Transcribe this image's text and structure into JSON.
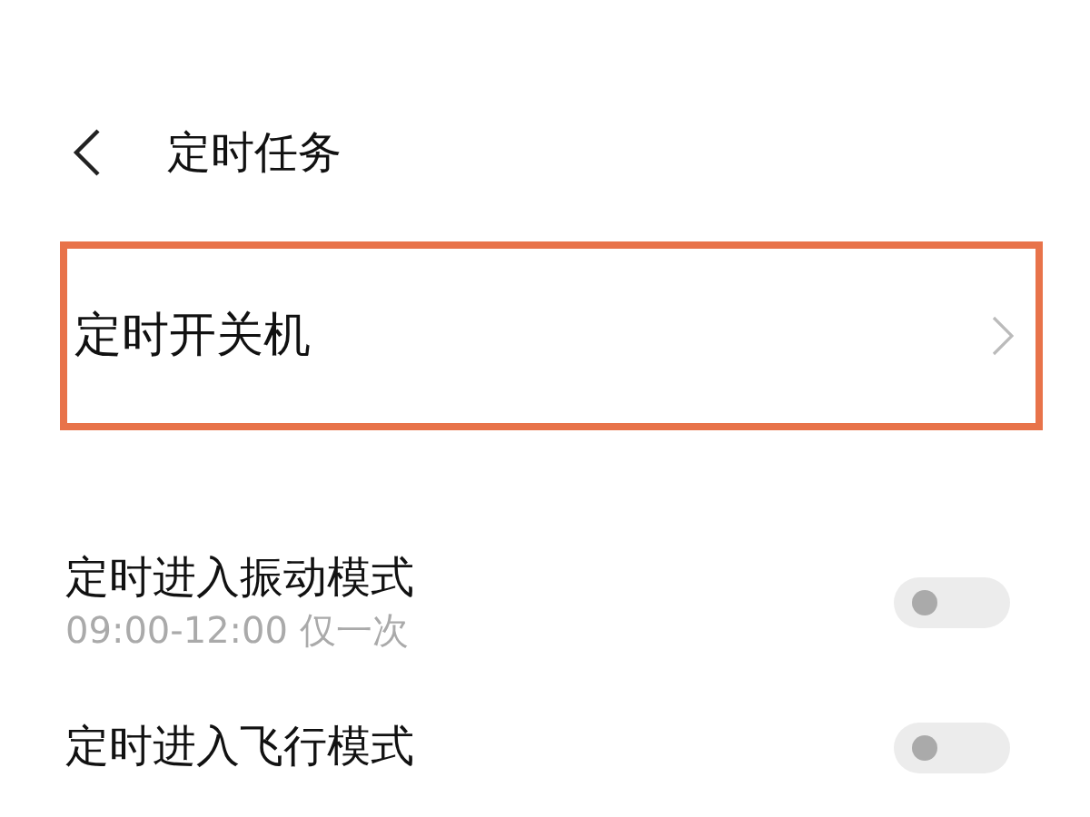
{
  "header": {
    "title": "定时任务"
  },
  "items": [
    {
      "kind": "link",
      "title": "定时开关机",
      "highlighted": true
    },
    {
      "kind": "toggle",
      "title": "定时进入振动模式",
      "subtitle": "09:00-12:00 仅一次",
      "on": false
    },
    {
      "kind": "toggle",
      "title": "定时进入飞行模式",
      "on": false
    }
  ]
}
